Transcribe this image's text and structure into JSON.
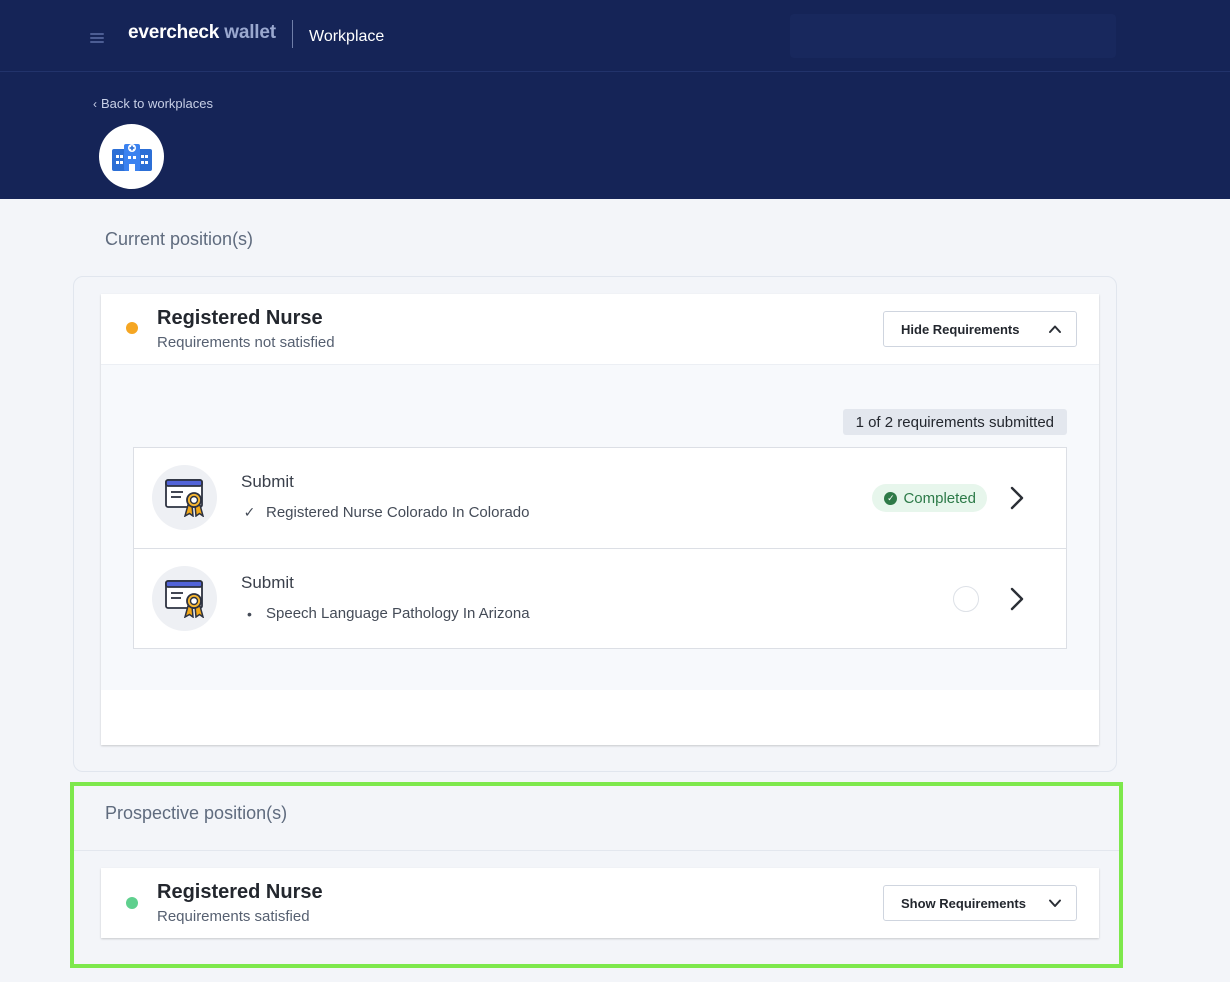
{
  "header": {
    "brand": {
      "name": "evercheck",
      "accent": "wallet"
    },
    "section": "Workplace"
  },
  "hero": {
    "back_link": "Back to workplaces",
    "org_avatar_icon": "hospital-icon"
  },
  "current": {
    "heading": "Current position(s)",
    "position": {
      "title": "Registered Nurse",
      "status_text": "Requirements not satisfied",
      "status_color": "#f5a623",
      "toggle_label": "Hide Requirements",
      "toggle_icon": "chevron-up-icon",
      "progress_badge": "1 of 2 requirements submitted",
      "requirements": [
        {
          "title": "Submit",
          "detail": "Registered Nurse Colorado In Colorado",
          "marker": "✓",
          "state": "Completed",
          "icon": "certificate-icon"
        },
        {
          "title": "Submit",
          "detail": "Speech Language Pathology In Arizona",
          "marker": "•",
          "state": "",
          "icon": "certificate-icon"
        }
      ]
    }
  },
  "prospective": {
    "heading": "Prospective position(s)",
    "position": {
      "title": "Registered Nurse",
      "status_text": "Requirements satisfied",
      "status_color": "#5fd08e",
      "toggle_label": "Show Requirements",
      "toggle_icon": "chevron-down-icon"
    }
  },
  "colors": {
    "header_bg": "#152457",
    "page_bg": "#f3f5f9",
    "highlight": "#7de84c",
    "completed_text": "#2c7a48"
  }
}
